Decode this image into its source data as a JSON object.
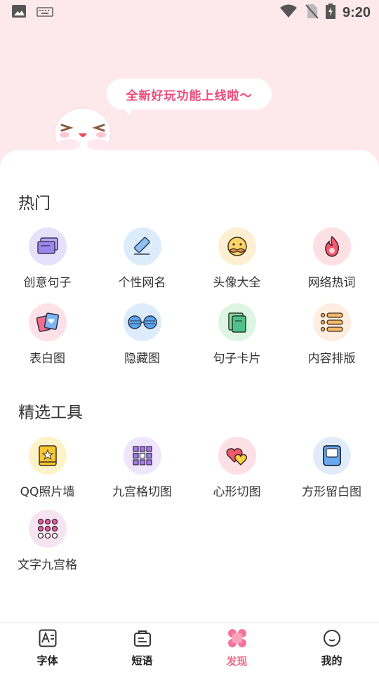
{
  "status_bar": {
    "time": "9:20"
  },
  "hero": {
    "bubble_text": "全新好玩功能上线啦～"
  },
  "sections": {
    "hot": {
      "title": "热门",
      "items": [
        {
          "label": "创意句子",
          "icon": "cards-icon",
          "bg": "#e6e1fb"
        },
        {
          "label": "个性网名",
          "icon": "pencil-icon",
          "bg": "#dcecfb"
        },
        {
          "label": "头像大全",
          "icon": "mustache-face-icon",
          "bg": "#fdf0d2"
        },
        {
          "label": "网络热词",
          "icon": "flame-icon",
          "bg": "#fde0e4"
        },
        {
          "label": "表白图",
          "icon": "heart-photos-icon",
          "bg": "#fde0e8"
        },
        {
          "label": "隐藏图",
          "icon": "glasses-icon",
          "bg": "#dcecfb"
        },
        {
          "label": "句子卡片",
          "icon": "card-stack-icon",
          "bg": "#dff5e3"
        },
        {
          "label": "内容排版",
          "icon": "list-icon",
          "bg": "#fdeee0"
        }
      ]
    },
    "tools": {
      "title": "精选工具",
      "items": [
        {
          "label": "QQ照片墙",
          "icon": "star-frame-icon",
          "bg": "#fdf3c8"
        },
        {
          "label": "九宫格切图",
          "icon": "grid-icon",
          "bg": "#efe6fb"
        },
        {
          "label": "心形切图",
          "icon": "hearts-icon",
          "bg": "#fde0e4"
        },
        {
          "label": "方形留白图",
          "icon": "square-frame-icon",
          "bg": "#e1ecfb"
        },
        {
          "label": "文字九宫格",
          "icon": "dots-grid-icon",
          "bg": "#f6e4f0"
        }
      ]
    }
  },
  "tabs": [
    {
      "label": "字体",
      "icon": "font-icon",
      "active": false
    },
    {
      "label": "短语",
      "icon": "briefcase-icon",
      "active": false
    },
    {
      "label": "发现",
      "icon": "clover-icon",
      "active": true
    },
    {
      "label": "我的",
      "icon": "profile-face-icon",
      "active": false
    }
  ],
  "colors": {
    "accent": "#f06a8c",
    "bubble_text": "#ee4b7a",
    "header_bg": "#fde9ec"
  }
}
